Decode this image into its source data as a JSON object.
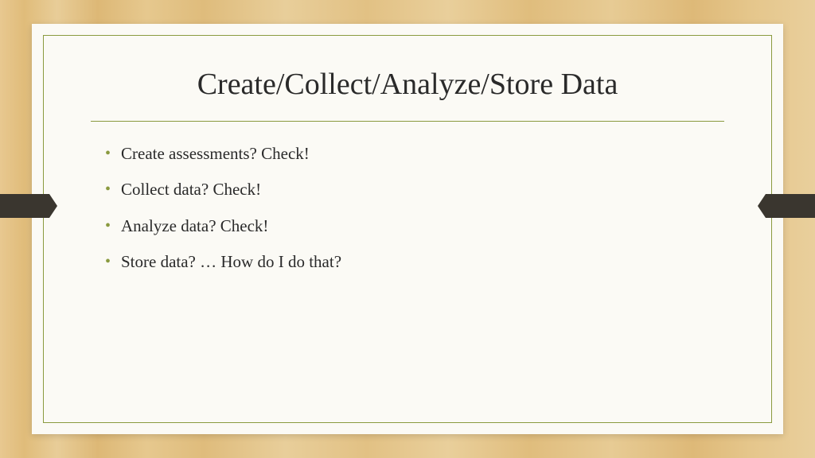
{
  "slide": {
    "title": "Create/Collect/Analyze/Store Data",
    "bullets": [
      "Create assessments? Check!",
      "Collect data? Check!",
      "Analyze data? Check!",
      "Store data? … How do I do that?"
    ]
  },
  "colors": {
    "accent": "#8a9a3f",
    "ribbon": "#3a362f",
    "paper": "#fbfaf5"
  }
}
